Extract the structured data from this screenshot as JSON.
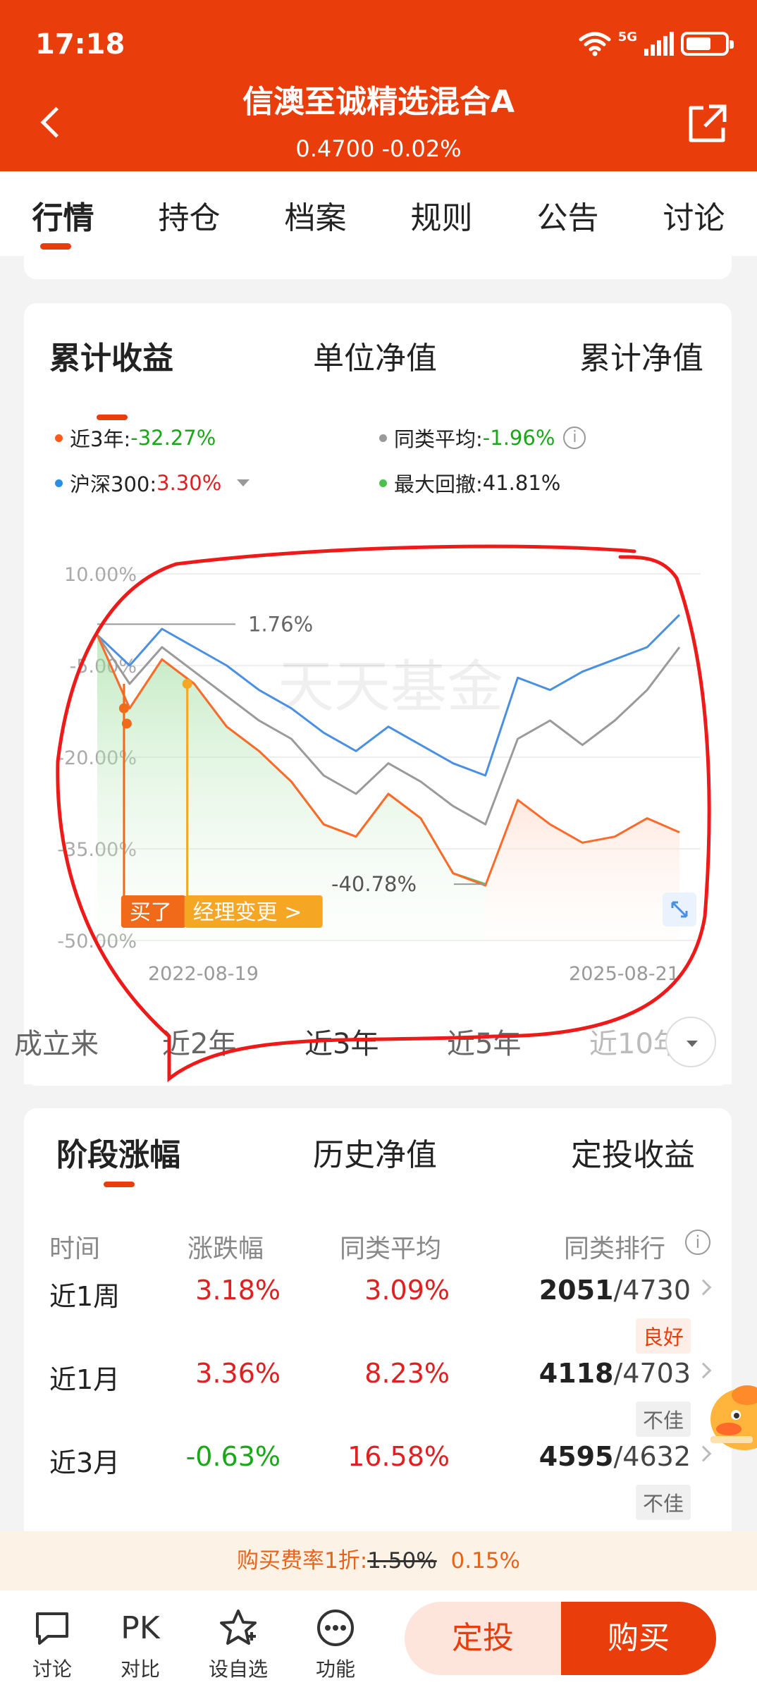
{
  "status_bar": {
    "time": "17:18",
    "network": "5G"
  },
  "header": {
    "title": "信澳至诚精选混合A",
    "nav_value": "0.4700",
    "nav_change": "-0.02%"
  },
  "tabs": [
    "行情",
    "持仓",
    "档案",
    "规则",
    "公告",
    "讨论"
  ],
  "chart_card": {
    "subtabs": [
      "累计收益",
      "单位净值",
      "累计净值"
    ],
    "legend": {
      "fund": {
        "label": "近3年:",
        "value": "-32.27%"
      },
      "category_avg": {
        "label": "同类平均:",
        "value": "-1.96%"
      },
      "index": {
        "label": "沪深300:",
        "value": "3.30%"
      },
      "max_drawdown": {
        "label": "最大回撤:",
        "value": "41.81%"
      }
    },
    "markers": {
      "buy": "买了",
      "manager_change": "经理变更 >"
    },
    "annotations": {
      "peak": "1.76%",
      "trough": "-40.78%"
    },
    "watermark": "天天基金",
    "range_options": [
      "成立来",
      "近2年",
      "近3年",
      "近5年",
      "近10年"
    ],
    "range_selected": "近3年"
  },
  "chart_data": {
    "type": "line",
    "ylim": [
      -50,
      10
    ],
    "yticks": [
      "10.00%",
      "-5.00%",
      "-20.00%",
      "-35.00%",
      "-50.00%"
    ],
    "x_start_label": "2022-08-19",
    "x_end_label": "2025-08-21",
    "x": [
      "2022-08",
      "2022-10",
      "2022-12",
      "2023-02",
      "2023-04",
      "2023-06",
      "2023-08",
      "2023-10",
      "2023-12",
      "2024-02",
      "2024-04",
      "2024-06",
      "2024-08",
      "2024-10",
      "2024-12",
      "2025-02",
      "2025-04",
      "2025-06",
      "2025-08"
    ],
    "series": [
      {
        "name": "近3年",
        "color": "#ff6a2a",
        "values": [
          0,
          -12,
          -4,
          -8,
          -15,
          -19,
          -24,
          -31,
          -33,
          -26,
          -30,
          -39,
          -41,
          -27,
          -31,
          -34,
          -33,
          -30,
          -32.3
        ]
      },
      {
        "name": "同类平均",
        "color": "#9a9a9a",
        "values": [
          0,
          -8,
          -2,
          -6,
          -10,
          -14,
          -17,
          -23,
          -26,
          -21,
          -24,
          -28,
          -31,
          -17,
          -14,
          -18,
          -14,
          -9,
          -2.0
        ]
      },
      {
        "name": "沪深300",
        "color": "#4a90e2",
        "values": [
          0,
          -5,
          1,
          -2,
          -5,
          -9,
          -12,
          -16,
          -19,
          -15,
          -18,
          -21,
          -23,
          -7,
          -9,
          -6,
          -4,
          -2,
          3.3
        ]
      },
      {
        "name": "最大回撤",
        "color": "#5cc45c",
        "values": [
          0,
          -12,
          -4,
          -8,
          -15,
          -19,
          -24,
          -31,
          -33,
          -26,
          -30,
          -39,
          -40.78
        ]
      }
    ]
  },
  "period_card": {
    "subtabs": [
      "阶段涨幅",
      "历史净值",
      "定投收益"
    ],
    "headers": [
      "时间",
      "涨跌幅",
      "同类平均",
      "同类排行"
    ],
    "rows": [
      {
        "period": "近1周",
        "change": "3.18%",
        "avg": "3.09%",
        "rank": "2051",
        "total": "/4730",
        "badge": "良好"
      },
      {
        "period": "近1月",
        "change": "3.36%",
        "avg": "8.23%",
        "rank": "4118",
        "total": "/4703",
        "badge": "不佳"
      },
      {
        "period": "近3月",
        "change": "-0.63%",
        "avg": "16.58%",
        "rank": "4595",
        "total": "/4632",
        "badge": "不佳"
      }
    ]
  },
  "fee": {
    "label": "购买费率1折:",
    "original": "1.50%",
    "current": "0.15%"
  },
  "bottom_nav": {
    "items": [
      "讨论",
      "对比",
      "设自选",
      "功能"
    ],
    "pk_text": "PK",
    "dingtou": "定投",
    "buy": "购买"
  },
  "colors": {
    "brand": "#ea3d0c",
    "up": "#e02020",
    "down": "#18a818"
  }
}
